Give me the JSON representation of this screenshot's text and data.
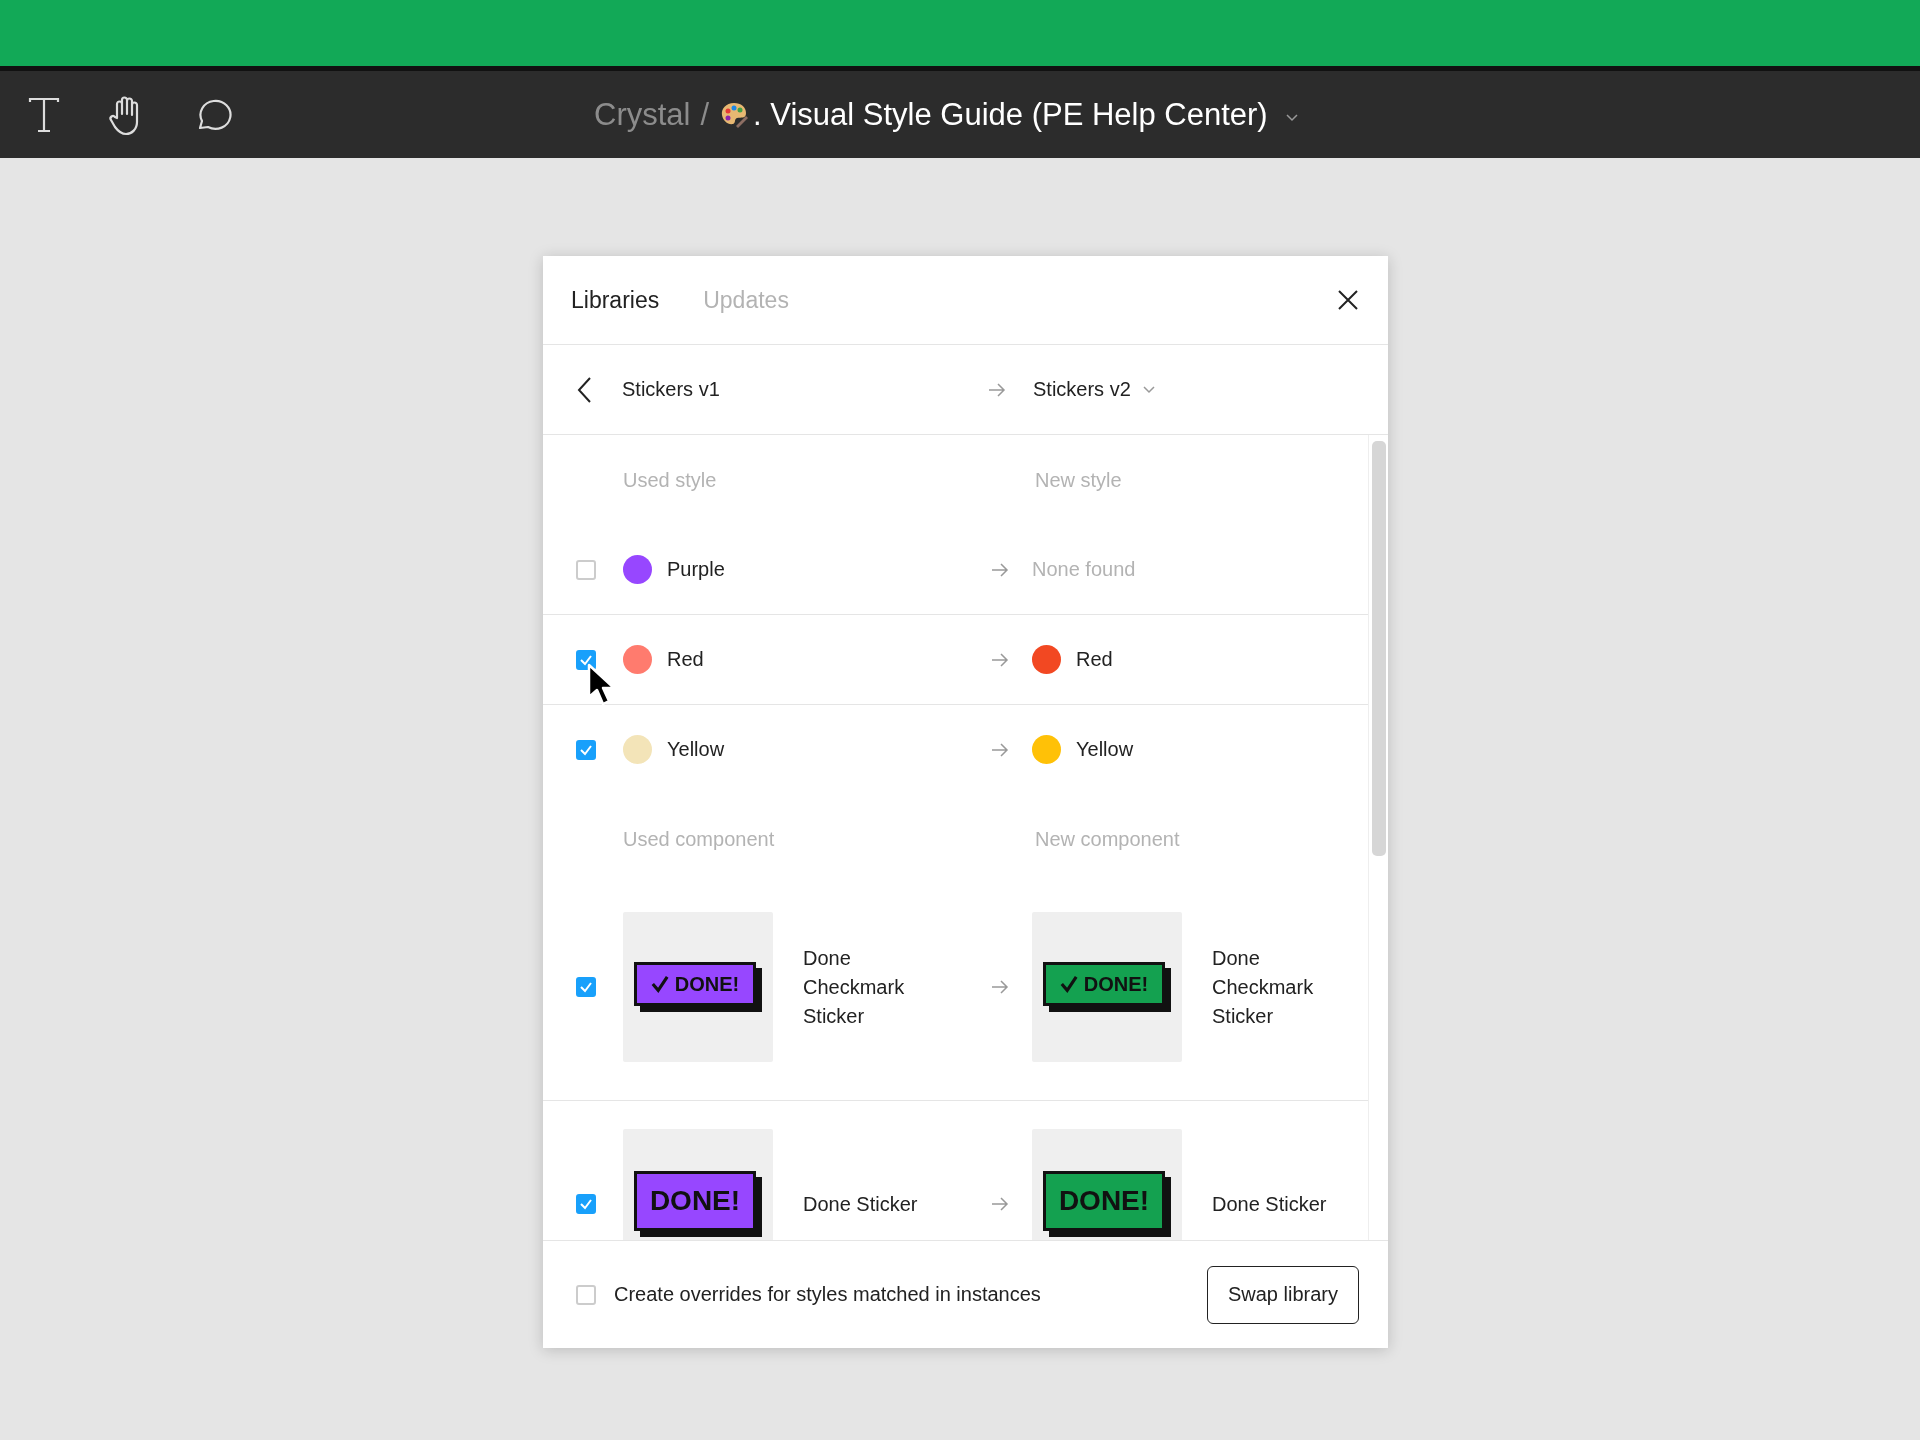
{
  "toolbar": {
    "tools": [
      {
        "kind": "text"
      },
      {
        "kind": "hand"
      },
      {
        "kind": "comment"
      }
    ]
  },
  "breadcrumb": {
    "project": "Crystal",
    "separator": "/",
    "file": ". Visual Style Guide (PE Help Center)"
  },
  "dialog": {
    "tabs": [
      {
        "label": "Libraries",
        "selected": true
      },
      {
        "label": "Updates",
        "selected": false
      }
    ],
    "from_library": "Stickers v1",
    "to_library": "Stickers v2",
    "sections": [
      {
        "kind": "style",
        "used_heading": "Used style",
        "new_heading": "New style",
        "rows": [
          {
            "checked": false,
            "used": {
              "name": "Purple",
              "color": "#9747ff"
            },
            "new": {
              "name": "None found",
              "found": false
            }
          },
          {
            "checked": true,
            "used": {
              "name": "Red",
              "color": "#ff7b6e"
            },
            "new": {
              "name": "Red",
              "found": true,
              "color": "#f24822"
            }
          },
          {
            "checked": true,
            "used": {
              "name": "Yellow",
              "color": "#f3e4b8"
            },
            "new": {
              "name": "Yellow",
              "found": true,
              "color": "#ffc107"
            }
          }
        ]
      },
      {
        "kind": "component",
        "used_heading": "Used component",
        "new_heading": "New component",
        "rows": [
          {
            "checked": true,
            "used": {
              "name": "Done Checkmark Sticker",
              "color": "#9747ff",
              "sticker_text": "DONE!",
              "tick": true
            },
            "new": {
              "name": "Done Checkmark Sticker",
              "color": "#14a150",
              "sticker_text": "DONE!",
              "tick": true
            }
          },
          {
            "checked": true,
            "used": {
              "name": "Done Sticker",
              "color": "#9747ff",
              "sticker_text": "DONE!",
              "tick": false
            },
            "new": {
              "name": "Done Sticker",
              "color": "#14a150",
              "sticker_text": "DONE!",
              "tick": false
            }
          }
        ]
      }
    ],
    "footer": {
      "checkbox": {
        "label": "Create overrides for styles matched in instances",
        "checked": false
      },
      "button": "Swap library"
    }
  }
}
